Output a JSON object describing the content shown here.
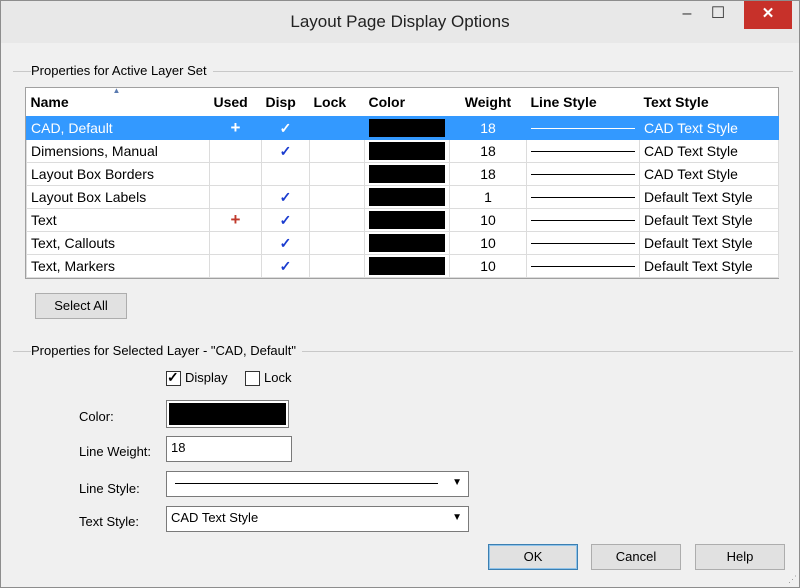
{
  "window": {
    "title": "Layout Page Display Options",
    "min_glyph": "–",
    "max_glyph": "☐",
    "close_glyph": "✕"
  },
  "group_layer_set": {
    "title": "Properties for Active Layer Set"
  },
  "table": {
    "headers": [
      "Name",
      "Used",
      "Disp",
      "Lock",
      "Color",
      "Weight",
      "Line Style",
      "Text Style"
    ],
    "rows": [
      {
        "name": "CAD,  Default",
        "used": "+",
        "used_color": "white",
        "disp": "✓",
        "lock": "",
        "color": "#000000",
        "weight": "18",
        "text_style": "CAD Text Style",
        "selected": true
      },
      {
        "name": "Dimensions,  Manual",
        "used": "",
        "disp": "✓",
        "lock": "",
        "color": "#000000",
        "weight": "18",
        "text_style": "CAD Text Style",
        "selected": false
      },
      {
        "name": "Layout Box Borders",
        "used": "",
        "disp": "",
        "lock": "",
        "color": "#000000",
        "weight": "18",
        "text_style": "CAD Text Style",
        "selected": false
      },
      {
        "name": "Layout Box Labels",
        "used": "",
        "disp": "✓",
        "lock": "",
        "color": "#000000",
        "weight": "1",
        "text_style": "Default Text Style",
        "selected": false
      },
      {
        "name": "Text",
        "used": "+",
        "used_color": "red",
        "disp": "✓",
        "lock": "",
        "color": "#000000",
        "weight": "10",
        "text_style": "Default Text Style",
        "selected": false
      },
      {
        "name": "Text,  Callouts",
        "used": "",
        "disp": "✓",
        "lock": "",
        "color": "#000000",
        "weight": "10",
        "text_style": "Default Text Style",
        "selected": false
      },
      {
        "name": "Text,  Markers",
        "used": "",
        "disp": "✓",
        "lock": "",
        "color": "#000000",
        "weight": "10",
        "text_style": "Default Text Style",
        "selected": false
      }
    ]
  },
  "select_all_label": "Select All",
  "group_selected": {
    "title": "Properties for Selected Layer - \"CAD,  Default\""
  },
  "display_checkbox": {
    "label": "Display",
    "checked": true
  },
  "lock_checkbox": {
    "label": "Lock",
    "checked": false
  },
  "color_label": "Color:",
  "color_value": "#000000",
  "line_weight_label": "Line Weight:",
  "line_weight_value": "18",
  "line_style_label": "Line Style:",
  "text_style_label": "Text Style:",
  "text_style_value": "CAD Text Style",
  "buttons": {
    "ok": "OK",
    "cancel": "Cancel",
    "help": "Help"
  },
  "colors": {
    "selection": "#3399ff",
    "close_button": "#c7312a",
    "check": "#1a3ccf",
    "used_red": "#c0392b"
  }
}
